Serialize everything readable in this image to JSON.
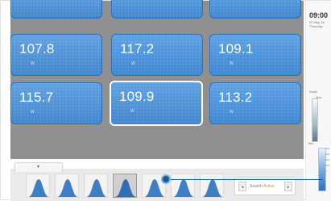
{
  "tiles": [
    {
      "value": "",
      "unit": ""
    },
    {
      "value": "",
      "unit": ""
    },
    {
      "value": "",
      "unit": ""
    },
    {
      "value": "107.8",
      "unit": "W"
    },
    {
      "value": "117.2",
      "unit": "W"
    },
    {
      "value": "109.1",
      "unit": "W"
    },
    {
      "value": "115.7",
      "unit": "W"
    },
    {
      "value": "109.9",
      "unit": "W",
      "selected": true
    },
    {
      "value": "113.2",
      "unit": "W"
    }
  ],
  "side_panel": {
    "clock": "09:00",
    "date": "02 May 18 Thursday",
    "scale_title": "Scale",
    "scale_top": "Max",
    "scale_bottom": "Min"
  },
  "legend_ticks": [
    "400",
    "300",
    "200",
    "100",
    "0"
  ],
  "strip_tab_glyph": "▾",
  "nav": {
    "prev_glyph": "◂",
    "next_glyph": "▸",
    "label": "Search",
    "accent": "Active"
  },
  "colors": {
    "tile_blue": "#4a8fd6",
    "grid_gray": "#8f8f8f",
    "cursor_blue": "#1f5a8a",
    "accent_orange": "#e58a2b"
  }
}
